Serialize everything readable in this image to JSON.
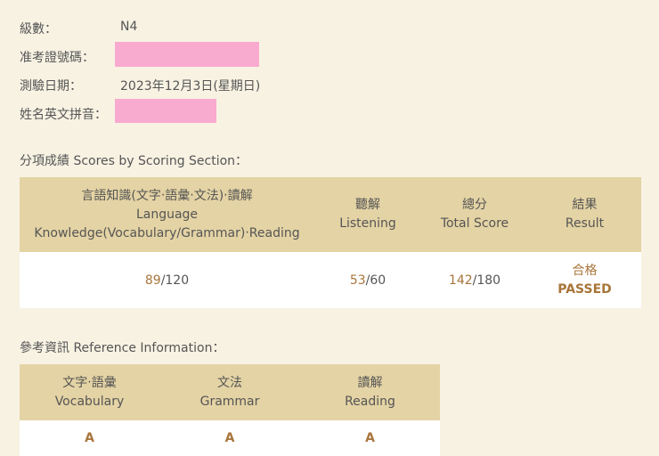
{
  "info": {
    "level_label": "級數：",
    "level_value": "N4",
    "exam_number_label": "准考證號碼：",
    "date_label": "測驗日期：",
    "date_value": "2023年12月3日(星期日)",
    "name_label": "姓名英文拼音："
  },
  "scores": {
    "title": "分項成績 Scores by Scoring Section：",
    "headers": {
      "language_zh": "言語知識(文字‧語彙‧文法)‧讀解",
      "language_en1": "Language",
      "language_en2": "Knowledge(Vocabulary/Grammar)‧Reading",
      "listening_zh": "聽解",
      "listening_en": "Listening",
      "total_zh": "總分",
      "total_en": "Total Score",
      "result_zh": "結果",
      "result_en": "Result"
    },
    "values": {
      "language_score": "89",
      "language_max": "/120",
      "listening_score": "53",
      "listening_max": "/60",
      "total_score": "142",
      "total_max": "/180",
      "result_zh": "合格",
      "result_en": "PASSED"
    }
  },
  "reference": {
    "title": "參考資訊 Reference Information：",
    "headers": {
      "vocab_zh": "文字‧語彙",
      "vocab_en": "Vocabulary",
      "grammar_zh": "文法",
      "grammar_en": "Grammar",
      "reading_zh": "讀解",
      "reading_en": "Reading"
    },
    "values": {
      "vocab": "A",
      "grammar": "A",
      "reading": "A"
    }
  },
  "colors": {
    "background": "#f8f2e3",
    "header_bg": "#e4d3a4",
    "highlight": "#a8753a",
    "redaction": "#f9aacf"
  }
}
